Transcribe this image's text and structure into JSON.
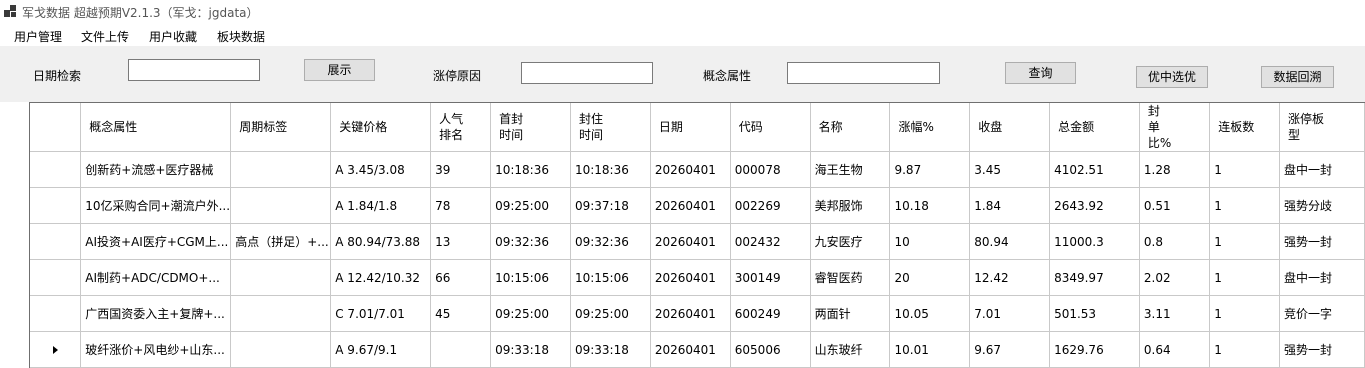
{
  "window": {
    "title": "军戈数据 超越预期V2.1.3（军戈：jgdata）"
  },
  "menu": {
    "items": [
      "用户管理",
      "文件上传",
      "用户收藏",
      "板块数据"
    ]
  },
  "toolbar": {
    "date_label": "日期检索",
    "date_value": "",
    "show_button": "展示",
    "reason_label": "涨停原因",
    "reason_value": "",
    "concept_label": "概念属性",
    "concept_value": "",
    "query_button": "查询",
    "select_button": "优中选优",
    "backtest_button": "数据回溯"
  },
  "grid": {
    "columns": [
      "概念属性",
      "周期标签",
      "关键价格",
      "人气排名",
      "首封时间",
      "封住时间",
      "日期",
      "代码",
      "名称",
      "涨幅%",
      "收盘",
      "总金额",
      "封单比%",
      "连板数",
      "涨停板型"
    ],
    "rows": [
      [
        "创新药+流感+医疗器械",
        "",
        "A 3.45/3.08",
        "39",
        "10:18:36",
        "10:18:36",
        "20260401",
        "000078",
        "海王生物",
        "9.87",
        "3.45",
        "4102.51",
        "1.28",
        "1",
        "盘中一封"
      ],
      [
        "10亿采购合同+潮流户外...",
        "",
        "A 1.84/1.8",
        "78",
        "09:25:00",
        "09:37:18",
        "20260401",
        "002269",
        "美邦服饰",
        "10.18",
        "1.84",
        "2643.92",
        "0.51",
        "1",
        "强势分歧"
      ],
      [
        "AI投资+AI医疗+CGM上...",
        "高点（拼足）+...",
        "A 80.94/73.88",
        "13",
        "09:32:36",
        "09:32:36",
        "20260401",
        "002432",
        "九安医疗",
        "10",
        "80.94",
        "11000.3",
        "0.8",
        "1",
        "强势一封"
      ],
      [
        "AI制药+ADC/CDMO+...",
        "",
        "A 12.42/10.32",
        "66",
        "10:15:06",
        "10:15:06",
        "20260401",
        "300149",
        "睿智医药",
        "20",
        "12.42",
        "8349.97",
        "2.02",
        "1",
        "盘中一封"
      ],
      [
        "广西国资委入主+复牌+...",
        "",
        "C 7.01/7.01",
        "45",
        "09:25:00",
        "09:25:00",
        "20260401",
        "600249",
        "两面针",
        "10.05",
        "7.01",
        "501.53",
        "3.11",
        "1",
        "竞价一字"
      ],
      [
        "玻纤涨价+风电纱+山东...",
        "",
        "A 9.67/9.1",
        "",
        "09:33:18",
        "09:33:18",
        "20260401",
        "605006",
        "山东玻纤",
        "10.01",
        "9.67",
        "1629.76",
        "0.64",
        "1",
        "强势一封"
      ]
    ],
    "current_row_index": 5
  }
}
